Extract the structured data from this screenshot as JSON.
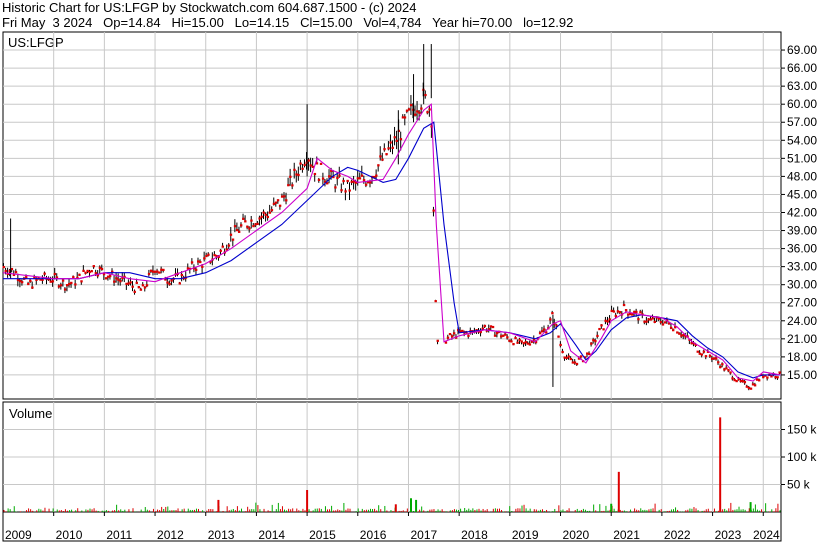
{
  "header": {
    "line1": "Historic Chart for US:LFGP by Stockwatch.com 604.687.1500 - (c) 2024",
    "line2": "Fri May  3 2024   Op=14.84   Hi=15.00   Lo=14.15   Cl=15.00   Vol=4,784   Year hi=70.00   lo=12.92"
  },
  "chart_data": [
    {
      "type": "line",
      "title": "US:LFGP",
      "x_range": [
        2009.0,
        2024.35
      ],
      "ylim": [
        11,
        72
      ],
      "y_ticks": [
        15,
        18,
        21,
        24,
        27,
        30,
        33,
        36,
        39,
        42,
        45,
        48,
        51,
        54,
        57,
        60,
        63,
        66,
        69
      ],
      "y_tick_labels": [
        "15.00",
        "18.00",
        "21.00",
        "24.00",
        "27.00",
        "30.00",
        "33.00",
        "36.00",
        "39.00",
        "42.00",
        "45.00",
        "48.00",
        "51.00",
        "54.00",
        "57.00",
        "60.00",
        "63.00",
        "66.00",
        "69.00"
      ],
      "grid": true,
      "colors": {
        "price": "#dd0000",
        "range": "#000000",
        "ma_short": "#cc00cc",
        "ma_long": "#0000cc"
      },
      "series": [
        {
          "key": "price",
          "x": [
            2009.0,
            2009.25,
            2009.5,
            2009.75,
            2010.0,
            2010.25,
            2010.5,
            2010.75,
            2011.0,
            2011.25,
            2011.5,
            2011.75,
            2012.0,
            2012.25,
            2012.5,
            2012.75,
            2013.0,
            2013.25,
            2013.5,
            2013.75,
            2014.0,
            2014.25,
            2014.5,
            2014.75,
            2015.0,
            2015.1,
            2015.2,
            2015.4,
            2015.6,
            2015.8,
            2016.0,
            2016.25,
            2016.5,
            2016.75,
            2017.0,
            2017.15,
            2017.3,
            2017.45,
            2017.5,
            2017.55,
            2017.75,
            2018.0,
            2018.25,
            2018.5,
            2018.75,
            2019.0,
            2019.25,
            2019.5,
            2019.75,
            2019.85,
            2020.0,
            2020.1,
            2020.25,
            2020.5,
            2020.75,
            2021.0,
            2021.25,
            2021.5,
            2021.75,
            2022.0,
            2022.25,
            2022.5,
            2022.75,
            2023.0,
            2023.25,
            2023.5,
            2023.75,
            2024.0,
            2024.2,
            2024.34
          ],
          "y": [
            33,
            32,
            30,
            31,
            31,
            30,
            31,
            33,
            32,
            31,
            30,
            29,
            33,
            31,
            31,
            33,
            34,
            35,
            38,
            40,
            41,
            42,
            44,
            48,
            52,
            50,
            49,
            48,
            47,
            46,
            47,
            48,
            51,
            54,
            58,
            60,
            61,
            59,
            40,
            20,
            21,
            22,
            22,
            23,
            22,
            21,
            20,
            21,
            23,
            25,
            20,
            18,
            17,
            18,
            22,
            25,
            26,
            25,
            24,
            24,
            23,
            21,
            19,
            18,
            16,
            14,
            13,
            15,
            15,
            15
          ]
        },
        {
          "key": "ma_short",
          "x": [
            2009.0,
            2009.5,
            2010.0,
            2010.5,
            2011.0,
            2011.5,
            2012.0,
            2012.5,
            2013.0,
            2013.5,
            2014.0,
            2014.5,
            2015.0,
            2015.2,
            2015.5,
            2015.8,
            2016.0,
            2016.5,
            2016.75,
            2017.0,
            2017.3,
            2017.45,
            2017.55,
            2017.7,
            2018.0,
            2018.5,
            2019.0,
            2019.5,
            2019.85,
            2020.0,
            2020.2,
            2020.5,
            2020.8,
            2021.0,
            2021.3,
            2021.6,
            2022.0,
            2022.3,
            2022.6,
            2022.9,
            2023.2,
            2023.5,
            2023.8,
            2024.0,
            2024.34
          ],
          "y": [
            32,
            31.5,
            31,
            31,
            32,
            31,
            30.5,
            32,
            33.5,
            36,
            39,
            42,
            46,
            51,
            49,
            48,
            47,
            47.5,
            51,
            55,
            59,
            60,
            40,
            20.5,
            21.5,
            22.5,
            22,
            20.5,
            23.5,
            24,
            19,
            17,
            21,
            24,
            25.5,
            25,
            24.5,
            23,
            20.5,
            19,
            17.5,
            14.5,
            14,
            15.5,
            15
          ]
        },
        {
          "key": "ma_long",
          "x": [
            2009.0,
            2009.5,
            2010.0,
            2010.5,
            2011.0,
            2011.5,
            2012.0,
            2012.5,
            2013.0,
            2013.5,
            2014.0,
            2014.5,
            2015.0,
            2015.5,
            2015.8,
            2016.0,
            2016.5,
            2016.75,
            2017.0,
            2017.3,
            2017.5,
            2017.7,
            2017.9,
            2018.0,
            2018.5,
            2019.0,
            2019.5,
            2019.8,
            2020.0,
            2020.3,
            2020.5,
            2020.7,
            2021.0,
            2021.3,
            2021.6,
            2022.0,
            2022.3,
            2022.6,
            2022.9,
            2023.2,
            2023.5,
            2023.8,
            2024.0,
            2024.34
          ],
          "y": [
            31,
            31,
            31,
            31,
            32,
            32,
            31,
            31,
            32,
            34,
            37,
            40,
            44,
            48,
            49.5,
            49,
            47,
            47.5,
            51,
            56,
            57,
            40,
            27,
            22,
            22.5,
            22,
            21,
            22,
            23.5,
            20,
            17.5,
            19,
            22.5,
            24.5,
            25,
            24.5,
            24,
            21.5,
            19.5,
            18,
            15.5,
            14.5,
            15,
            15
          ]
        }
      ],
      "spikes": [
        {
          "x": 2009.15,
          "high": 41,
          "low": 31
        },
        {
          "x": 2015.0,
          "high": 60,
          "low": 48
        },
        {
          "x": 2016.8,
          "high": 59,
          "low": 50
        },
        {
          "x": 2017.1,
          "high": 65,
          "low": 57
        },
        {
          "x": 2017.3,
          "high": 70,
          "low": 60
        },
        {
          "x": 2017.45,
          "high": 70,
          "low": 61
        },
        {
          "x": 2019.85,
          "high": 25,
          "low": 13
        }
      ],
      "year_labels": [
        "2009",
        "2010",
        "2011",
        "2012",
        "2013",
        "2014",
        "2015",
        "2016",
        "2017",
        "2018",
        "2019",
        "2020",
        "2021",
        "2022",
        "2023",
        "2024"
      ]
    },
    {
      "type": "bar",
      "title": "Volume",
      "ylim": [
        0,
        200000
      ],
      "y_ticks": [
        50000,
        100000,
        150000
      ],
      "y_tick_labels": [
        "50 k",
        "100 k",
        "150 k"
      ],
      "colors": {
        "down": "#dd0000",
        "up": "#00aa00"
      },
      "spikes": [
        {
          "x": 2015.0,
          "value": 40000,
          "color": "#dd0000"
        },
        {
          "x": 2013.25,
          "value": 22000,
          "color": "#dd0000"
        },
        {
          "x": 2016.75,
          "value": 14000,
          "color": "#dd0000"
        },
        {
          "x": 2017.05,
          "value": 25000,
          "color": "#00aa00"
        },
        {
          "x": 2017.15,
          "value": 22000,
          "color": "#00aa00"
        },
        {
          "x": 2021.15,
          "value": 73000,
          "color": "#dd0000"
        },
        {
          "x": 2023.15,
          "value": 172000,
          "color": "#dd0000"
        },
        {
          "x": 2023.75,
          "value": 18000,
          "color": "#00aa00"
        },
        {
          "x": 2021.0,
          "value": 15000,
          "color": "#00aa00"
        }
      ]
    }
  ]
}
